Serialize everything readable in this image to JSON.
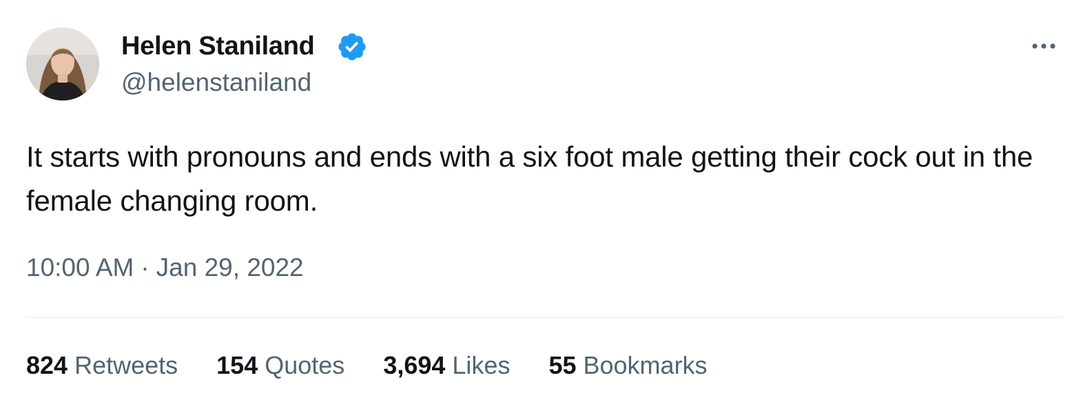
{
  "author": {
    "display_name": "Helen Staniland",
    "handle": "@helenstaniland",
    "verified_color": "#1d9bf0"
  },
  "tweet": {
    "text": "It starts with pronouns and ends with a six foot male getting their cock out in the female changing room.",
    "time": "10:00 AM",
    "separator": "·",
    "date": "Jan 29, 2022"
  },
  "stats": {
    "retweets_count": "824",
    "retweets_label": "Retweets",
    "quotes_count": "154",
    "quotes_label": "Quotes",
    "likes_count": "3,694",
    "likes_label": "Likes",
    "bookmarks_count": "55",
    "bookmarks_label": "Bookmarks"
  },
  "icons": {
    "verified": "verified-badge-icon",
    "more": "more-options-icon"
  }
}
